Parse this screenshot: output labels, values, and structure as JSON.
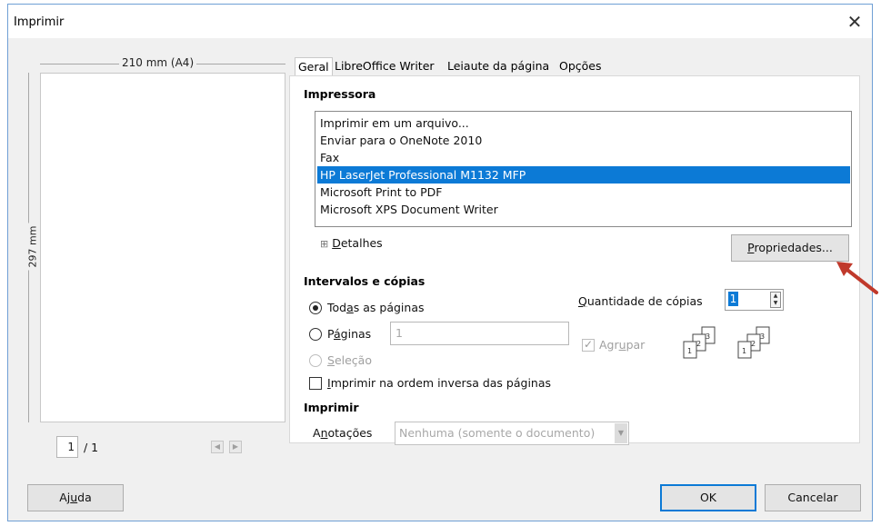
{
  "window": {
    "title": "Imprimir",
    "close_glyph": "✕"
  },
  "preview": {
    "width_label": "210 mm (A4)",
    "height_label": "297 mm",
    "current_page": "1",
    "page_total": "/ 1"
  },
  "tabs": [
    {
      "label": "Geral"
    },
    {
      "label": "LibreOffice Writer"
    },
    {
      "label": "Leiaute da página"
    },
    {
      "label": "Opções"
    }
  ],
  "printer": {
    "section_label": "Impressora",
    "items": [
      "Imprimir em um arquivo...",
      "Enviar para o OneNote 2010",
      "Fax",
      "HP LaserJet Professional M1132 MFP",
      "Microsoft Print to PDF",
      "Microsoft XPS Document Writer"
    ],
    "selected_index": 3,
    "details_prefix": "⊞",
    "details_accel": "D",
    "details_rest": "etalhes",
    "properties_accel": "P",
    "properties_rest": "ropriedades..."
  },
  "range": {
    "section_label": "Intervalos e cópias",
    "all_pre": "Tod",
    "all_accel": "a",
    "all_rest": "s as páginas",
    "pages_pre": "P",
    "pages_accel": "á",
    "pages_rest": "ginas",
    "pages_value": "1",
    "selection_accel": "S",
    "selection_rest": "eleção",
    "reverse_accel": "I",
    "reverse_rest": "mprimir na ordem inversa das páginas",
    "copies_accel": "Q",
    "copies_rest": "uantidade de cópias",
    "copies_value": "1",
    "collate_pre": "Agr",
    "collate_accel": "u",
    "collate_rest": "par"
  },
  "print": {
    "section_label": "Imprimir",
    "comments_pre": "A",
    "comments_accel": "n",
    "comments_rest": "otações",
    "comments_value": "Nenhuma (somente o documento)"
  },
  "footer": {
    "help_pre": "Aj",
    "help_accel": "u",
    "help_rest": "da",
    "ok_label": "OK",
    "cancel_label": "Cancelar"
  },
  "colors": {
    "selection": "#0c7ad6",
    "annotation_arrow": "#c0392b"
  },
  "icons": {
    "close": "close-icon",
    "collate_stack": "collate-pages-icon",
    "annotation": "arrow-annotation"
  }
}
